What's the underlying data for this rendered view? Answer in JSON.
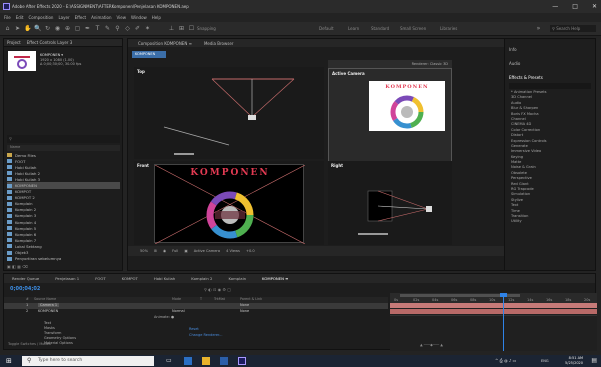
{
  "app": {
    "title": "Adobe After Effects 2020 - E:\\ASSIGNMENT\\AFTERKomponen\\Penjelasan KOMPONEN.aep",
    "window_buttons": [
      "—",
      "□",
      "✕"
    ]
  },
  "menu": [
    "File",
    "Edit",
    "Composition",
    "Layer",
    "Effect",
    "Animation",
    "View",
    "Window",
    "Help"
  ],
  "toolbar": {
    "snapping": "Snapping",
    "workspaces": [
      "Default",
      "Learn",
      "Standard",
      "Small Screen",
      "Libraries"
    ],
    "search_placeholder": "Search Help"
  },
  "project": {
    "tab": "Project",
    "tab2": "Effect Controls Layer 3",
    "comp_name": "KOMPONEN ▾",
    "comp_info": [
      "1920 x 1080 (1.00)",
      "Δ 0;00;30;00, 30.00 fps"
    ],
    "search_placeholder": "",
    "column": "Name",
    "items": [
      {
        "name": "Demo Files",
        "type": "folder"
      },
      {
        "name": "FOOT",
        "type": "comp"
      },
      {
        "name": "Hobi Kuliah",
        "type": "comp"
      },
      {
        "name": "Hobi Kuliah 2",
        "type": "comp"
      },
      {
        "name": "Hobi Kuliah 3",
        "type": "comp"
      },
      {
        "name": "KOMPONEN",
        "type": "comp",
        "selected": true
      },
      {
        "name": "KOMPOT",
        "type": "comp"
      },
      {
        "name": "KOMPOT 2",
        "type": "comp"
      },
      {
        "name": "Komplain",
        "type": "comp"
      },
      {
        "name": "Komplain 2",
        "type": "comp"
      },
      {
        "name": "Komplain 3",
        "type": "comp"
      },
      {
        "name": "Komplain 4",
        "type": "comp"
      },
      {
        "name": "Komplain 5",
        "type": "comp"
      },
      {
        "name": "Komplain 6",
        "type": "comp"
      },
      {
        "name": "Komplain 7",
        "type": "comp"
      },
      {
        "name": "Lokal Sektang",
        "type": "comp"
      },
      {
        "name": "Objek3",
        "type": "comp"
      },
      {
        "name": "Penyortiran sebelumnya",
        "type": "comp"
      }
    ]
  },
  "viewer": {
    "tabs": [
      "Composition KOMPONEN ≡",
      "Media Browser"
    ],
    "comp_chip": "KOMPONEN",
    "view_labels": {
      "top": "Top",
      "active": "Active Camera",
      "front": "Front",
      "right": "Right"
    },
    "renderer": "Renderer: Classic 3D",
    "title_text": "KOMPONEN",
    "viewbar": [
      "50%",
      "Full",
      "Active Camera",
      "4 Views",
      "+0.0"
    ]
  },
  "effects": {
    "tabs": [
      "Info",
      "Audio",
      "Effects & Presets"
    ],
    "items": [
      "* Animation Presets",
      "3D Channel",
      "Audio",
      "Blur & Sharpen",
      "Boris FX Mocha",
      "Channel",
      "CINEMA 4D",
      "Color Correction",
      "Distort",
      "Expression Controls",
      "Generate",
      "Immersive Video",
      "Keying",
      "Matte",
      "Noise & Grain",
      "Obsolete",
      "Perspective",
      "Red Giant",
      "RG Trapcode",
      "Simulation",
      "Stylize",
      "Text",
      "Time",
      "Transition",
      "Utility"
    ]
  },
  "timeline": {
    "tabs": [
      "Render Queue",
      "Penjelasan 1",
      "FOOT",
      "KOMPOT",
      "Hobi Kuliah",
      "Komplain 2",
      "Komplain",
      "KOMPONEN ≡"
    ],
    "timecode": "0;00;04;02",
    "columns": [
      "#",
      "Source Name",
      "Mode",
      "T",
      "TrkMat",
      "Parent & Link"
    ],
    "layers": [
      {
        "num": "1",
        "name": "Camera 1",
        "mode": "",
        "parent": "None"
      },
      {
        "num": "2",
        "name": "KOMPONEN",
        "mode": "Normal",
        "parent": "None"
      }
    ],
    "props": [
      "Text",
      "Masks",
      "Transform",
      "Geometry Options",
      "Material Options"
    ],
    "prop_values": [
      "Reset",
      "Change Renderer..."
    ],
    "animate": "Animate: ●",
    "ruler_marks": [
      "0s",
      "02s",
      "04s",
      "06s",
      "08s",
      "10s",
      "12s",
      "14s",
      "16s",
      "18s",
      "20s"
    ],
    "toggle": "Toggle Switches / Modes"
  },
  "taskbar": {
    "search": "Type here to search",
    "time": "8:51 AM",
    "date": "5/25/2020",
    "lang": "ENG"
  },
  "colors": {
    "accent": "#2f83e8",
    "layer_bar": "#c67a78",
    "label_red": "#e23a52",
    "chart_yellow": "#f0c030",
    "chart_green": "#4fb050",
    "chart_blue": "#3790d0",
    "chart_pink": "#d0449a",
    "chart_purple": "#7b4ab8"
  }
}
